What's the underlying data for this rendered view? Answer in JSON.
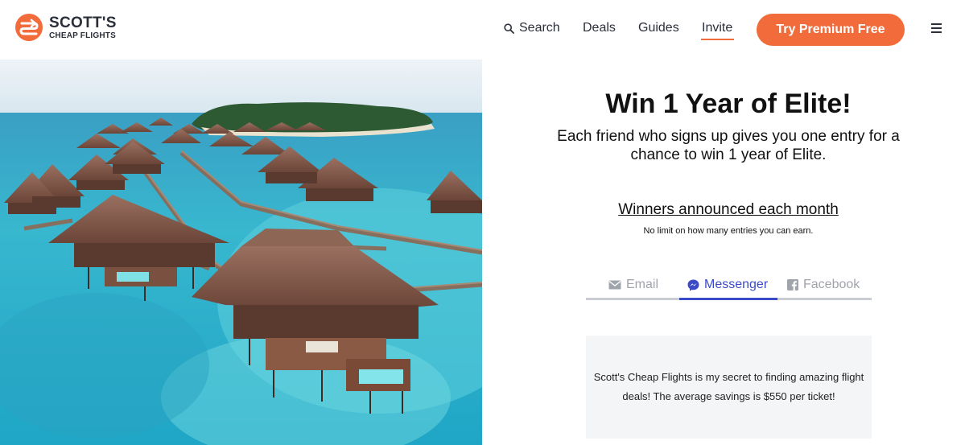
{
  "brand": {
    "title": "SCOTT'S",
    "subtitle": "CHEAP FLIGHTS",
    "accent_color": "#f26b3a"
  },
  "nav": {
    "search": "Search",
    "deals": "Deals",
    "guides": "Guides",
    "invite": "Invite",
    "premium_button": "Try Premium Free",
    "menu_icon": "hamburger-icon"
  },
  "hero": {
    "icon": "overwater-bungalows-photo"
  },
  "content": {
    "headline": "Win 1 Year of Elite!",
    "subhead": "Each friend who signs up gives you one entry for a chance to win 1 year of Elite.",
    "winners_link": "Winners announced each month",
    "no_limit": "No limit on how many entries you can earn."
  },
  "share_tabs": [
    {
      "label": "Email",
      "icon": "envelope-icon",
      "active": false
    },
    {
      "label": "Messenger",
      "icon": "messenger-icon",
      "active": true
    },
    {
      "label": "Facebook",
      "icon": "facebook-icon",
      "active": false
    }
  ],
  "share_message": "Scott's Cheap Flights is my secret to finding amazing flight deals! The average savings is $550 per ticket!",
  "colors": {
    "active_tab": "#3b4bc8",
    "inactive_tab": "#a0a4ab"
  }
}
